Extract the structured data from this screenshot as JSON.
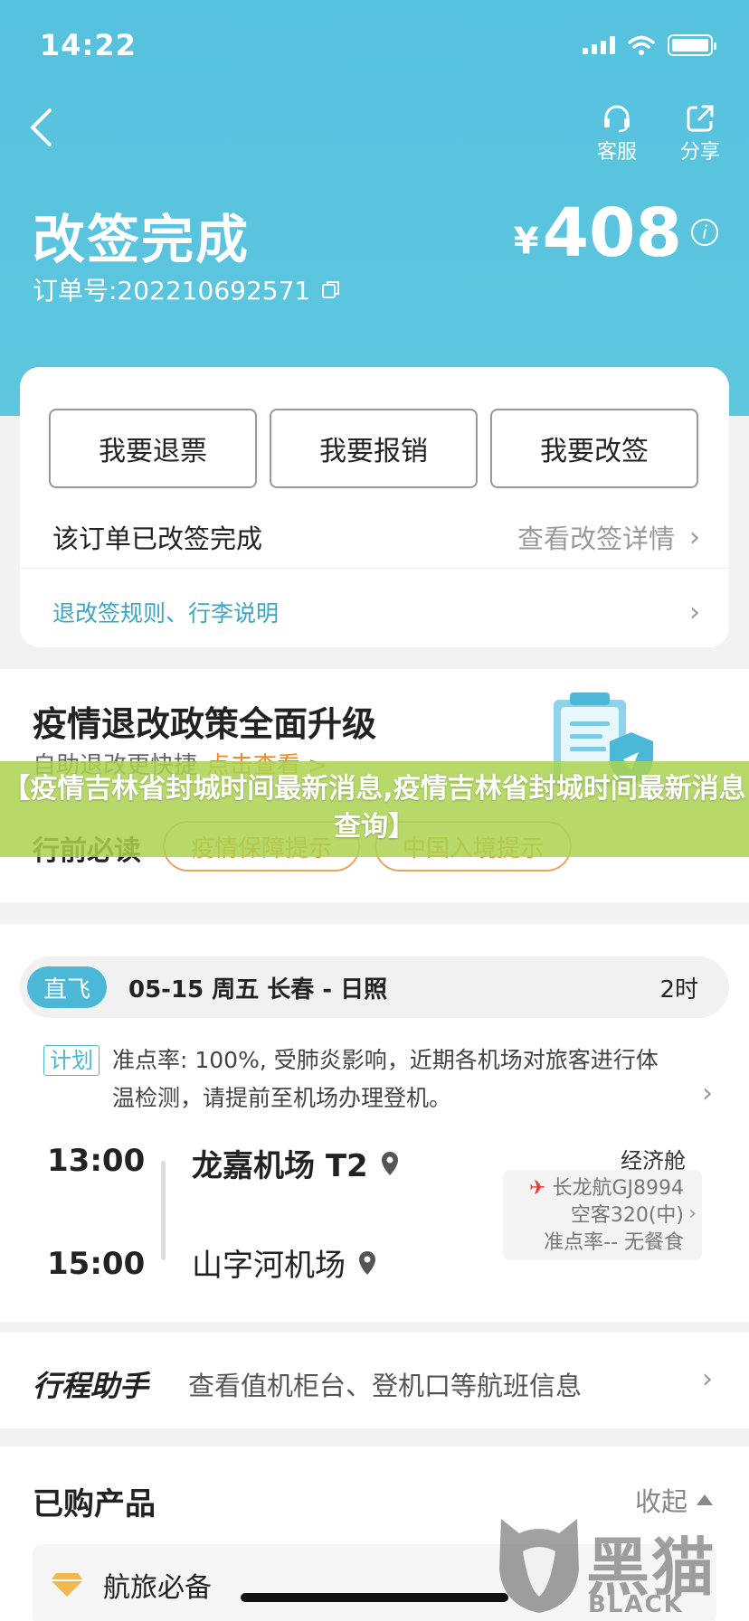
{
  "status_bar": {
    "time": "14:22"
  },
  "header": {
    "top_actions": [
      {
        "label": "客服",
        "icon": "headset-icon"
      },
      {
        "label": "分享",
        "icon": "share-icon"
      }
    ],
    "title": "改签完成",
    "order_label": "订单号:202210692571",
    "price_currency": "¥",
    "price_value": "408"
  },
  "actions": {
    "buttons": [
      "我要退票",
      "我要报销",
      "我要改签"
    ],
    "status_text": "该订单已改签完成",
    "details_link": "查看改签详情",
    "rules_link": "退改签规则、行李说明"
  },
  "policy": {
    "title": "疫情退改政策全面升级",
    "subtitle": "自助退改更快捷",
    "subtitle_link": "点击查看 >",
    "pre_travel_label": "行前必读",
    "pills": [
      "疫情保障提示",
      "中国入境提示"
    ]
  },
  "banner": {
    "text": "【疫情吉林省封城时间最新消息,疫情吉林省封城时间最新消息查询】"
  },
  "flight": {
    "tag": "直飞",
    "date_route": "05-15 周五 长春 - 日照",
    "duration": "2时",
    "plan_tag": "计划",
    "plan_text": "准点率: 100%, 受肺炎影响，近期各机场对旅客进行体温检测，请提前至机场办理登机。",
    "dep_time": "13:00",
    "arr_time": "15:00",
    "dep_airport": "龙嘉机场 T2",
    "arr_airport": "山字河机场",
    "cabin": "经济舱",
    "airline": "长龙航GJ8994",
    "aircraft": "空客320(中)",
    "punctuality": "准点率-- 无餐食"
  },
  "assistant": {
    "label": "行程助手",
    "text": "查看值机柜台、登机口等航班信息"
  },
  "purchased": {
    "title": "已购产品",
    "collapse": "收起",
    "item": "航旅必备"
  },
  "watermark": {
    "cn": "黑猫",
    "en": "BLACK CAT"
  },
  "colors": {
    "header": "#55c2de",
    "accent": "#4cb8d8",
    "orange": "#f08a24",
    "banner": "#aad250"
  }
}
